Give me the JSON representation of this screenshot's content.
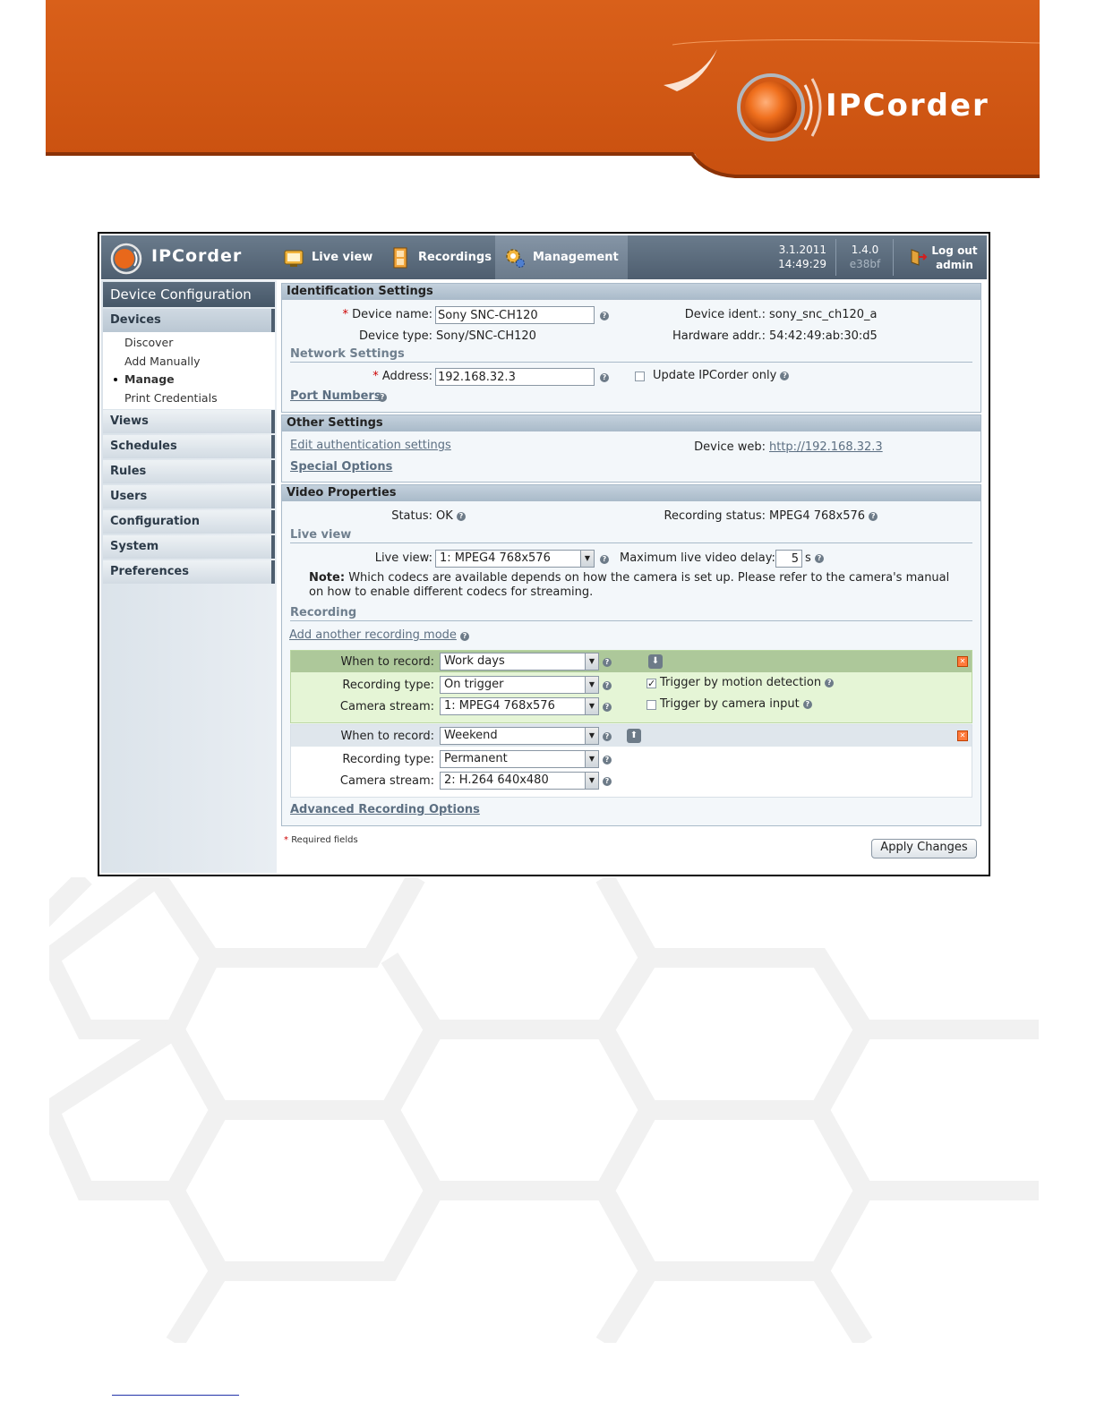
{
  "banner": {
    "brand": "IPCorder"
  },
  "app": {
    "name": "IPCorder"
  },
  "topbar": {
    "nav": [
      {
        "label": "Live view",
        "icon": "monitor-icon"
      },
      {
        "label": "Recordings",
        "icon": "film-icon"
      },
      {
        "label": "Management",
        "icon": "gear-icon"
      }
    ],
    "date": "3.1.2011",
    "time": "14:49:29",
    "version": "1.4.0",
    "build": "e38bf",
    "logout_line1": "Log out",
    "logout_line2": "admin"
  },
  "sidebar": {
    "title": "Device Configuration",
    "sections": [
      "Devices",
      "Views",
      "Schedules",
      "Rules",
      "Users",
      "Configuration",
      "System",
      "Preferences"
    ],
    "devices_sub": [
      "Discover",
      "Add Manually",
      "Manage",
      "Print Credentials"
    ]
  },
  "identification": {
    "title": "Identification Settings",
    "device_name_label": "Device name:",
    "device_name_value": "Sony SNC-CH120",
    "device_type_label": "Device type:",
    "device_type_value": "Sony/SNC-CH120",
    "device_ident_label": "Device ident.:",
    "device_ident_value": "sony_snc_ch120_a",
    "hardware_addr_label": "Hardware addr.:",
    "hardware_addr_value": "54:42:49:ab:30:d5",
    "network_settings": "Network Settings",
    "address_label": "Address:",
    "address_value": "192.168.32.3",
    "update_only_label": "Update IPCorder only",
    "port_numbers": "Port Numbers"
  },
  "other": {
    "title": "Other Settings",
    "edit_auth": "Edit authentication settings",
    "special_options": "Special Options",
    "device_web_label": "Device web:",
    "device_web_value": "http://192.168.32.3"
  },
  "video": {
    "title": "Video Properties",
    "status_label": "Status:",
    "status_value": "OK",
    "rec_status_label": "Recording status:",
    "rec_status_value": "MPEG4 768x576",
    "live_view_section": "Live view",
    "live_view_label": "Live view:",
    "live_view_value": "1: MPEG4 768x576",
    "max_delay_label": "Maximum live video delay:",
    "max_delay_value": "5",
    "max_delay_unit": "s",
    "note_bold": "Note:",
    "note_line1": "Which codecs are available depends on how the camera is set up. Please refer to the camera's manual",
    "note_line2": "on how to enable different codecs for streaming.",
    "recording_section": "Recording",
    "add_mode": "Add another recording mode",
    "when_label": "When to record:",
    "type_label": "Recording type:",
    "stream_label": "Camera stream:",
    "modes": [
      {
        "when": "Work days",
        "type": "On trigger",
        "stream": "1: MPEG4 768x576",
        "trigger_motion": "Trigger by motion detection",
        "trigger_input": "Trigger by camera input",
        "motion_checked": true,
        "input_checked": false
      },
      {
        "when": "Weekend",
        "type": "Permanent",
        "stream": "2: H.264 640x480"
      }
    ],
    "advanced": "Advanced Recording Options"
  },
  "footer": {
    "required": "Required fields",
    "apply": "Apply Changes"
  },
  "colors": {
    "brand_orange": "#d45a15",
    "toolbar": "#56677a",
    "panel_head": "#b3c3d1",
    "trigger_green": "#e5f5d6"
  }
}
